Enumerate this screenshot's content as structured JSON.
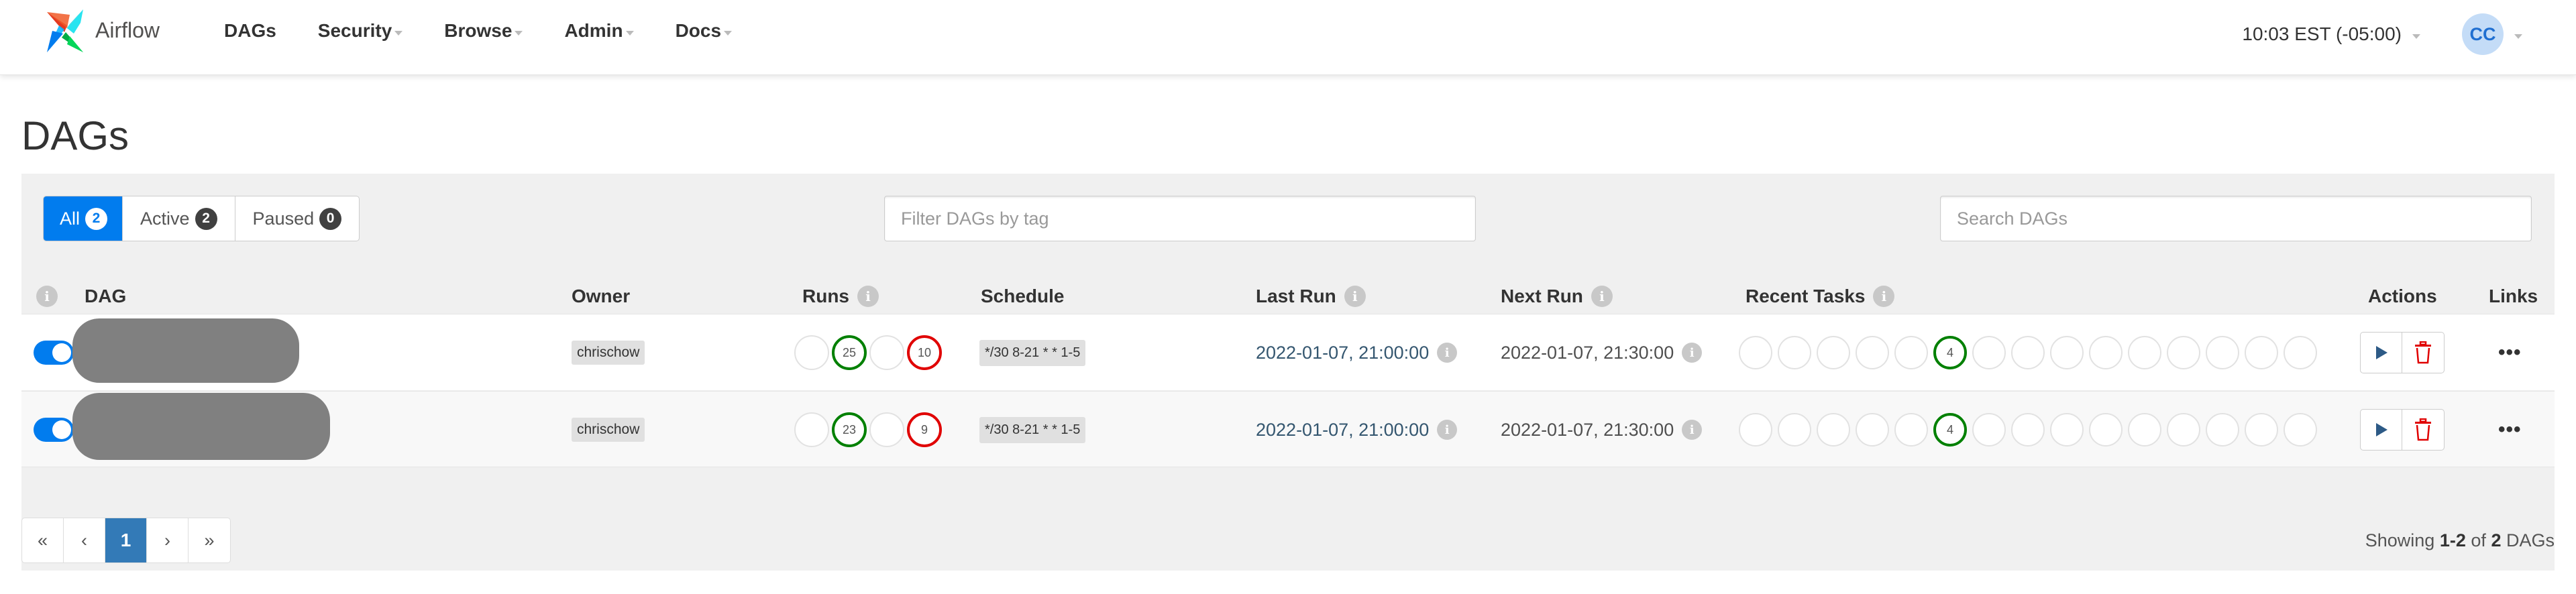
{
  "navbar": {
    "brand": "Airflow",
    "items": [
      {
        "label": "DAGs",
        "has_dropdown": false
      },
      {
        "label": "Security",
        "has_dropdown": true
      },
      {
        "label": "Browse",
        "has_dropdown": true
      },
      {
        "label": "Admin",
        "has_dropdown": true
      },
      {
        "label": "Docs",
        "has_dropdown": true
      }
    ],
    "clock": "10:03 EST (-05:00)",
    "user_initials": "CC"
  },
  "page": {
    "title": "DAGs"
  },
  "filters": {
    "status": [
      {
        "label": "All",
        "count": "2",
        "active": true
      },
      {
        "label": "Active",
        "count": "2",
        "active": false
      },
      {
        "label": "Paused",
        "count": "0",
        "active": false
      }
    ],
    "tag_placeholder": "Filter DAGs by tag",
    "search_placeholder": "Search DAGs"
  },
  "table": {
    "columns": {
      "dag": "DAG",
      "owner": "Owner",
      "runs": "Runs",
      "schedule": "Schedule",
      "last_run": "Last Run",
      "next_run": "Next Run",
      "recent_tasks": "Recent Tasks",
      "actions": "Actions",
      "links": "Links"
    },
    "info_glyph": "i",
    "rows": [
      {
        "dag_name": "[redacted]",
        "paused": false,
        "owner": "chrischow",
        "runs": [
          {
            "state": "none",
            "count": ""
          },
          {
            "state": "success",
            "count": "25"
          },
          {
            "state": "none",
            "count": ""
          },
          {
            "state": "failed",
            "count": "10"
          }
        ],
        "schedule": "*/30 8-21 * * 1-5",
        "last_run": "2022-01-07, 21:00:00",
        "next_run": "2022-01-07, 21:30:00",
        "recent_tasks": [
          "",
          "",
          "",
          "",
          "",
          "4",
          "",
          "",
          "",
          "",
          "",
          "",
          "",
          "",
          ""
        ],
        "recent_tasks_success_index": 5
      },
      {
        "dag_name": "[redacted]",
        "paused": false,
        "owner": "chrischow",
        "runs": [
          {
            "state": "none",
            "count": ""
          },
          {
            "state": "success",
            "count": "23"
          },
          {
            "state": "none",
            "count": ""
          },
          {
            "state": "failed",
            "count": "9"
          }
        ],
        "schedule": "*/30 8-21 * * 1-5",
        "last_run": "2022-01-07, 21:00:00",
        "next_run": "2022-01-07, 21:30:00",
        "recent_tasks": [
          "",
          "",
          "",
          "",
          "",
          "4",
          "",
          "",
          "",
          "",
          "",
          "",
          "",
          "",
          ""
        ],
        "recent_tasks_success_index": 5
      }
    ],
    "links_glyph": "•••"
  },
  "pagination": {
    "first": "«",
    "prev": "‹",
    "current": "1",
    "next": "›",
    "last": "»"
  },
  "summary": {
    "prefix": "Showing",
    "range": "1-2",
    "of": "of",
    "total": "2",
    "suffix": "DAGs"
  },
  "colors": {
    "primary": "#017cee",
    "success": "#008000",
    "failed": "#e00000",
    "pagination_active": "#337ab7",
    "delete_icon": "#e00000",
    "trigger_icon": "#2d5a86"
  }
}
